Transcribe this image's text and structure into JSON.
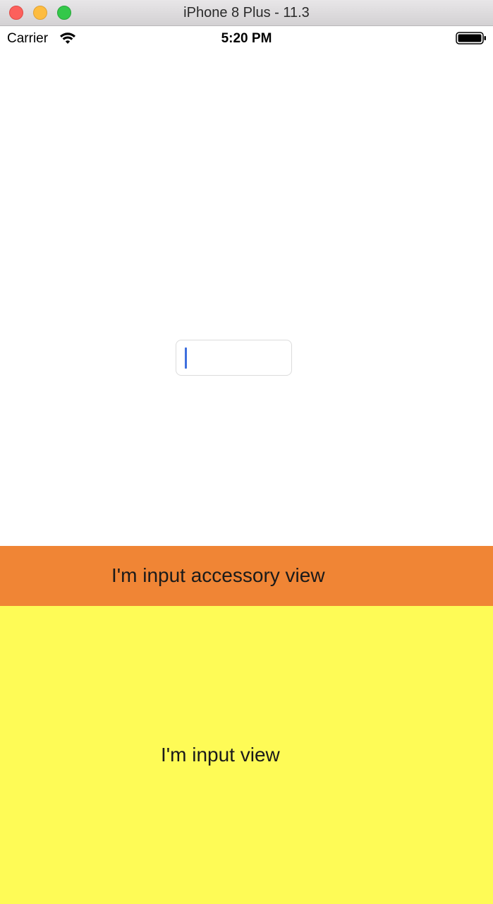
{
  "window": {
    "title": "iPhone 8 Plus - 11.3"
  },
  "status_bar": {
    "carrier": "Carrier",
    "time": "5:20 PM",
    "icons": [
      "wifi-icon",
      "battery-icon"
    ]
  },
  "text_field": {
    "value": "",
    "cursor_color": "#3e6fde"
  },
  "accessory_view": {
    "label": "I'm input accessory view",
    "color": "#f08535"
  },
  "input_view": {
    "label": "I'm input view",
    "color": "#fefb56"
  }
}
